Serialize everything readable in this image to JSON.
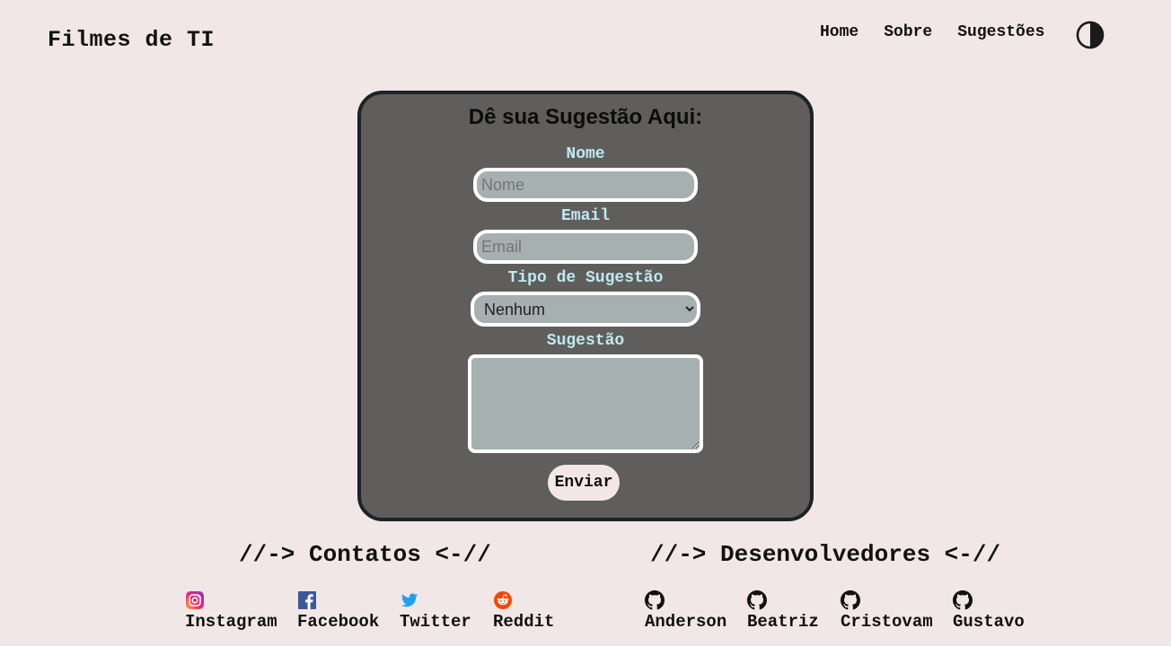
{
  "header": {
    "brand": "Filmes de TI",
    "nav": [
      "Home",
      "Sobre",
      "Sugestões"
    ],
    "theme_icon": "contrast-toggle-icon"
  },
  "form": {
    "title": "Dê sua Sugestão Aqui:",
    "name_label": "Nome",
    "name_placeholder": "Nome",
    "name_value": "",
    "email_label": "Email",
    "email_placeholder": "Email",
    "email_value": "",
    "type_label": "Tipo de Sugestão",
    "type_selected": "Nenhum",
    "suggestion_label": "Sugestão",
    "suggestion_value": "",
    "submit_label": "Enviar"
  },
  "footer": {
    "contacts_title": "//-> Contatos <-//",
    "contacts": [
      {
        "label": "Instagram",
        "icon": "instagram-icon"
      },
      {
        "label": "Facebook",
        "icon": "facebook-icon"
      },
      {
        "label": "Twitter",
        "icon": "twitter-icon"
      },
      {
        "label": "Reddit",
        "icon": "reddit-icon"
      }
    ],
    "devs_title": "//-> Desenvolvedores <-//",
    "devs": [
      {
        "label": "Anderson",
        "icon": "github-icon"
      },
      {
        "label": "Beatriz",
        "icon": "github-icon"
      },
      {
        "label": "Cristovam",
        "icon": "github-icon"
      },
      {
        "label": "Gustavo",
        "icon": "github-icon"
      }
    ]
  },
  "colors": {
    "page_bg": "#f1e7e6",
    "card_bg": "#5f5e5c",
    "card_border": "#1d2326",
    "label": "#bfe9ef",
    "field_bg": "#a7b0b0"
  }
}
